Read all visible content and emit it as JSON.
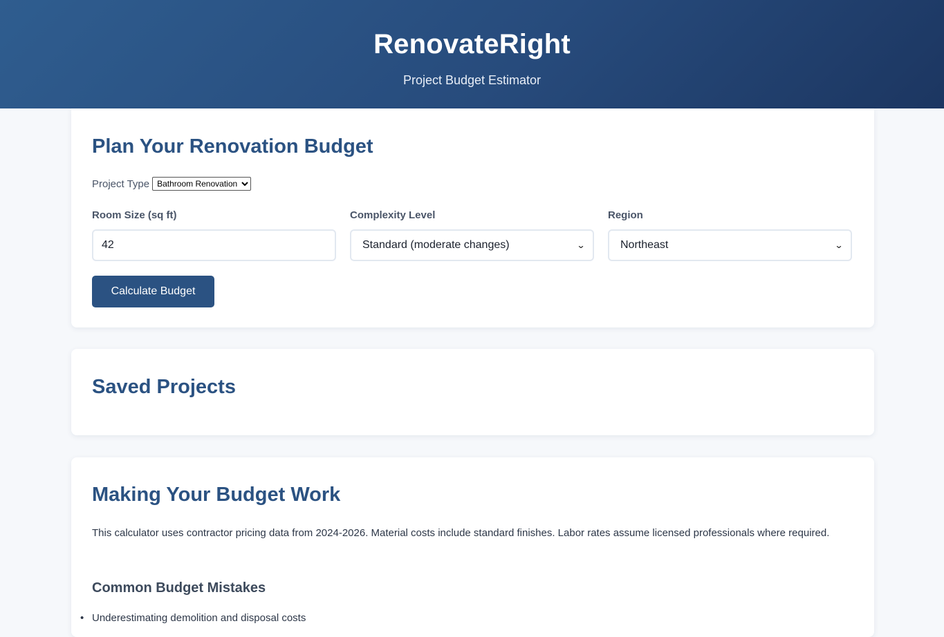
{
  "header": {
    "title": "RenovateRight",
    "subtitle": "Project Budget Estimator"
  },
  "planner": {
    "heading": "Plan Your Renovation Budget",
    "project_type_label": "Project Type",
    "project_type_value": "Bathroom Renovation",
    "room_size_label": "Room Size (sq ft)",
    "room_size_value": "42",
    "complexity_label": "Complexity Level",
    "complexity_value": "Standard (moderate changes)",
    "region_label": "Region",
    "region_value": "Northeast",
    "calculate_label": "Calculate Budget"
  },
  "saved": {
    "heading": "Saved Projects"
  },
  "tips": {
    "heading": "Making Your Budget Work",
    "intro": "This calculator uses contractor pricing data from 2024-2026. Material costs include standard finishes. Labor rates assume licensed professionals where required.",
    "subheading": "Common Budget Mistakes",
    "items": [
      "Underestimating demolition and disposal costs"
    ]
  },
  "colors": {
    "accent": "#2b5282",
    "header_start": "#2f5d8f",
    "header_end": "#1c3661",
    "background": "#f6f8fb"
  },
  "icons": {
    "select_arrow": "chevron-down-icon"
  }
}
